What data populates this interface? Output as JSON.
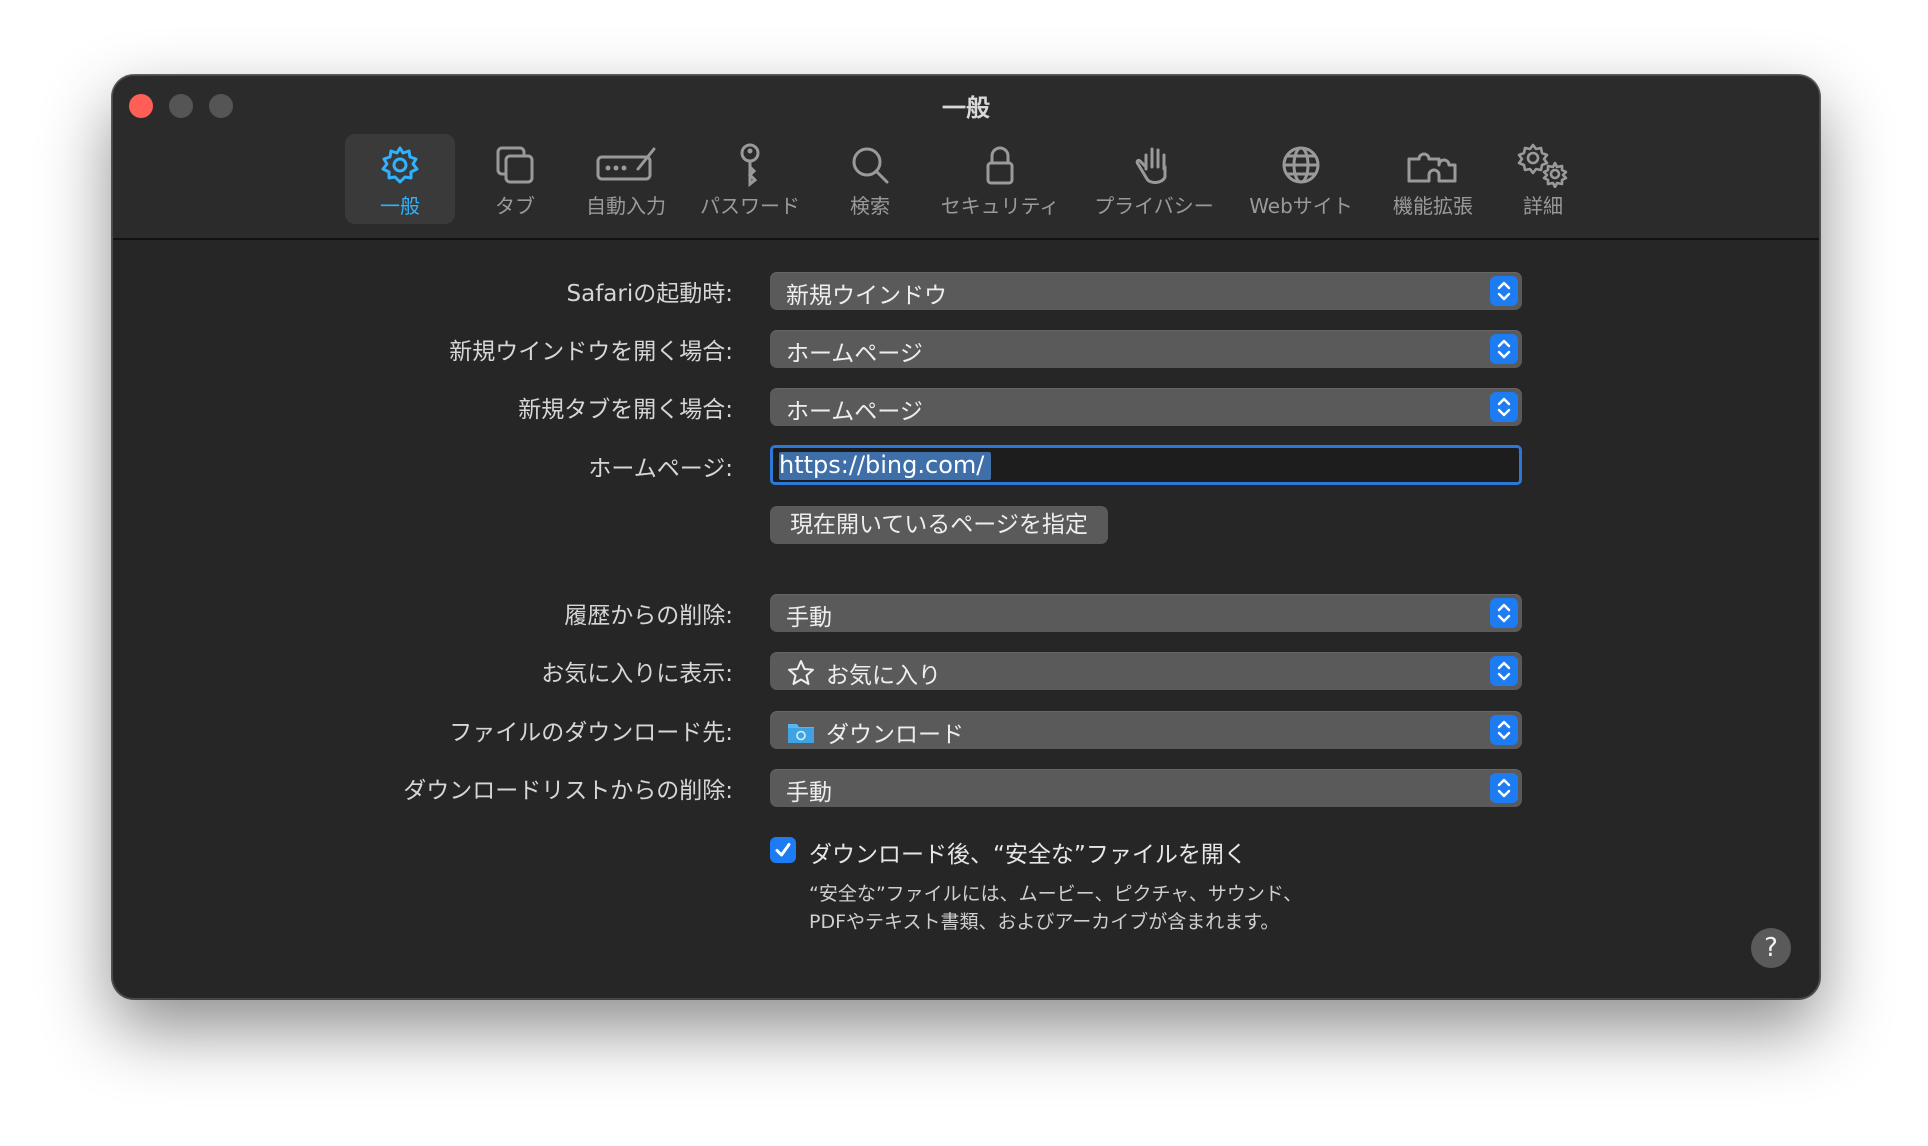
{
  "window": {
    "title": "一般"
  },
  "toolbar": {
    "items": [
      {
        "label": "一般",
        "icon": "gear-icon",
        "selected": true
      },
      {
        "label": "タブ",
        "icon": "tabs-icon"
      },
      {
        "label": "自動入力",
        "icon": "autofill-icon"
      },
      {
        "label": "パスワード",
        "icon": "key-icon"
      },
      {
        "label": "検索",
        "icon": "search-icon"
      },
      {
        "label": "セキュリティ",
        "icon": "lock-icon"
      },
      {
        "label": "プライバシー",
        "icon": "hand-icon"
      },
      {
        "label": "Webサイト",
        "icon": "globe-icon"
      },
      {
        "label": "機能拡張",
        "icon": "puzzle-icon"
      },
      {
        "label": "詳細",
        "icon": "gears-icon"
      }
    ]
  },
  "form": {
    "startup": {
      "label": "Safariの起動時:",
      "value": "新規ウインドウ"
    },
    "new_window": {
      "label": "新規ウインドウを開く場合:",
      "value": "ホームページ"
    },
    "new_tab": {
      "label": "新規タブを開く場合:",
      "value": "ホームページ"
    },
    "homepage": {
      "label": "ホームページ:",
      "value": "https://bing.com/"
    },
    "set_current_button": "現在開いているページを指定",
    "history_remove": {
      "label": "履歴からの削除:",
      "value": "手動"
    },
    "favorites_show": {
      "label": "お気に入りに表示:",
      "value": "お気に入り"
    },
    "download_location": {
      "label": "ファイルのダウンロード先:",
      "value": "ダウンロード"
    },
    "download_list_remove": {
      "label": "ダウンロードリストからの削除:",
      "value": "手動"
    },
    "open_safe_files": {
      "label": "ダウンロード後、“安全な”ファイルを開く",
      "checked": true,
      "note": "“安全な”ファイルには、ムービー、ピクチャ、サウンド、PDFやテキスト書類、およびアーカイブが含まれます。"
    }
  },
  "colors": {
    "accent": "#1e7cf2",
    "selected_tab": "#2fb2ff",
    "window_bg": "#262626",
    "close": "#ff5f57"
  }
}
